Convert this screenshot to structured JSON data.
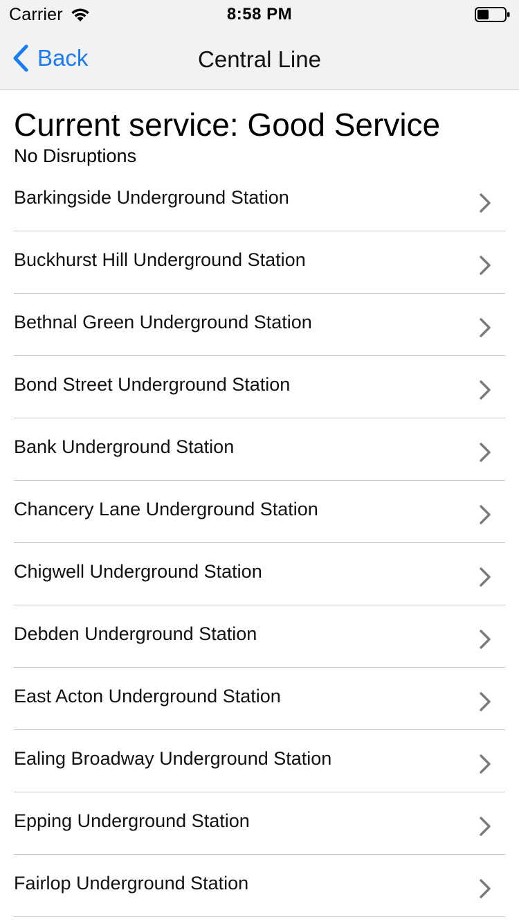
{
  "status_bar": {
    "carrier": "Carrier",
    "time": "8:58 PM",
    "wifi_icon": "wifi-icon",
    "battery_icon": "battery-icon"
  },
  "nav": {
    "back_label": "Back",
    "back_icon": "chevron-left-icon",
    "title": "Central Line",
    "accent_color": "#1a7cf5"
  },
  "service": {
    "title": "Current service: Good Service",
    "subtitle": "No Disruptions"
  },
  "stations": [
    {
      "name": "Barkingside Underground Station"
    },
    {
      "name": "Buckhurst Hill Underground Station"
    },
    {
      "name": "Bethnal Green Underground Station"
    },
    {
      "name": "Bond Street Underground Station"
    },
    {
      "name": "Bank Underground Station"
    },
    {
      "name": "Chancery Lane Underground Station"
    },
    {
      "name": "Chigwell Underground Station"
    },
    {
      "name": "Debden Underground Station"
    },
    {
      "name": "East Acton Underground Station"
    },
    {
      "name": "Ealing Broadway Underground Station"
    },
    {
      "name": "Epping Underground Station"
    },
    {
      "name": "Fairlop Underground Station"
    }
  ],
  "row_icon": "chevron-right-icon"
}
